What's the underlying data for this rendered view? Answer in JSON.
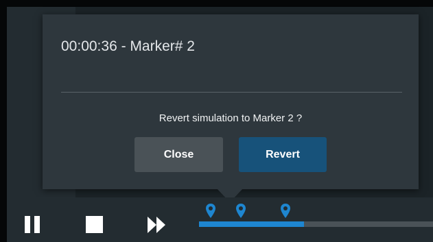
{
  "dialog": {
    "title": "00:00:36 - Marker# 2",
    "message": "Revert simulation to Marker 2 ?",
    "close_label": "Close",
    "revert_label": "Revert"
  },
  "controls": {
    "pause_icon": "pause-icon",
    "stop_icon": "stop-icon",
    "fast_forward_icon": "fast-forward-icon"
  },
  "timeline": {
    "progress": 0.45,
    "markers": [
      {
        "id": "marker-1",
        "position": 0.05
      },
      {
        "id": "marker-2",
        "position": 0.18
      },
      {
        "id": "marker-3",
        "position": 0.37
      }
    ]
  },
  "colors": {
    "accent": "#1e86d0",
    "revert_button": "#17527a",
    "close_button": "#4a5257",
    "dialog_bg": "#2e373d"
  }
}
